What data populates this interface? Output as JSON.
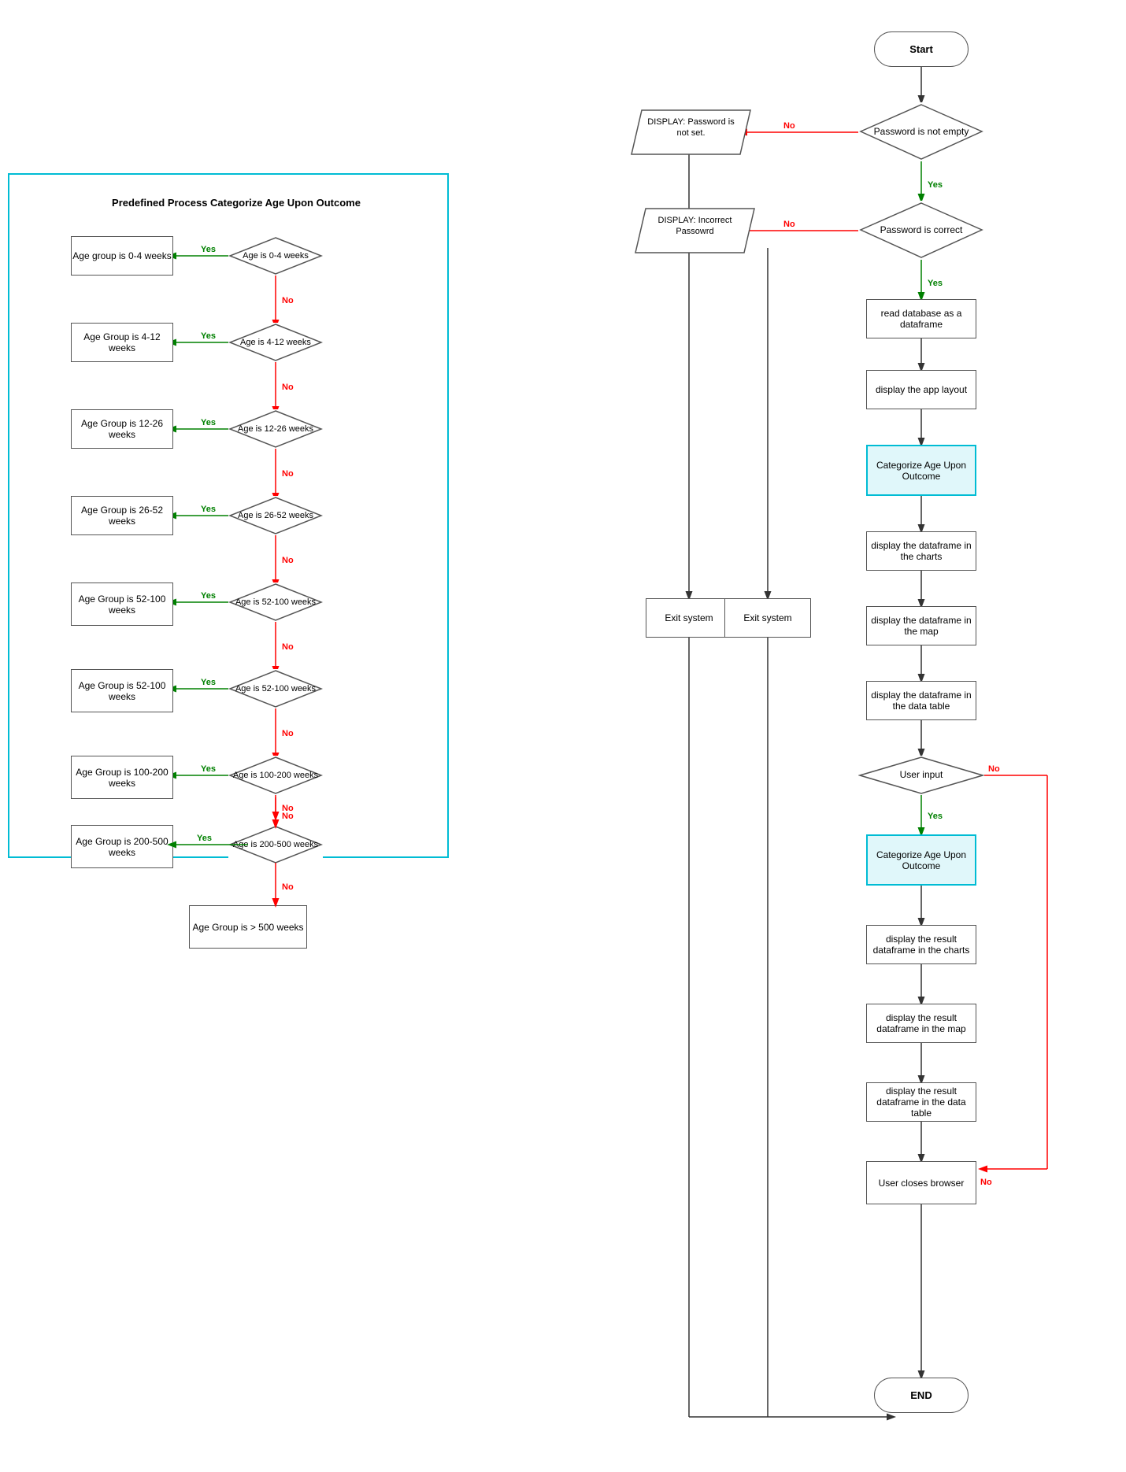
{
  "left_diagram": {
    "title": "Predefined Process Categorize Age Upon Outcome",
    "nodes": [
      {
        "id": "n1",
        "label": "Age group is 0-4 weeks",
        "type": "rect"
      },
      {
        "id": "n2",
        "label": "Age is 0-4 weeks",
        "type": "diamond"
      },
      {
        "id": "n3",
        "label": "Age Group is 4-12 weeks",
        "type": "rect"
      },
      {
        "id": "n4",
        "label": "Age is 4-12 weeks",
        "type": "diamond"
      },
      {
        "id": "n5",
        "label": "Age Group is 12-26 weeks",
        "type": "rect"
      },
      {
        "id": "n6",
        "label": "Age is 12-26 weeks",
        "type": "diamond"
      },
      {
        "id": "n7",
        "label": "Age Group is 26-52 weeks",
        "type": "rect"
      },
      {
        "id": "n8",
        "label": "Age is 26-52 weeks",
        "type": "diamond"
      },
      {
        "id": "n9",
        "label": "Age Group is 52-100 weeks",
        "type": "rect"
      },
      {
        "id": "n10",
        "label": "Age is 52-100 weeks",
        "type": "diamond"
      },
      {
        "id": "n11",
        "label": "Age Group is 52-100 weeks",
        "type": "rect"
      },
      {
        "id": "n12",
        "label": "Age is 52-100 weeks",
        "type": "diamond"
      },
      {
        "id": "n13",
        "label": "Age Group is 100-200 weeks",
        "type": "rect"
      },
      {
        "id": "n14",
        "label": "Age is 100-200 weeks",
        "type": "diamond"
      },
      {
        "id": "n15",
        "label": "Age Group is 200-500 weeks",
        "type": "rect"
      },
      {
        "id": "n16",
        "label": "Age is 200-500 weeks",
        "type": "diamond"
      },
      {
        "id": "n17",
        "label": "Age Group is > 500 weeks",
        "type": "rect"
      }
    ],
    "labels": {
      "yes": "Yes",
      "no": "No"
    }
  },
  "right_diagram": {
    "nodes": [
      {
        "id": "start",
        "label": "Start",
        "type": "rounded"
      },
      {
        "id": "d1",
        "label": "Password is not empty",
        "type": "diamond"
      },
      {
        "id": "disp1",
        "label": "DISPLAY: Password is not set.",
        "type": "parallelogram"
      },
      {
        "id": "d2",
        "label": "Password is correct",
        "type": "diamond"
      },
      {
        "id": "disp2",
        "label": "DISPLAY: Incorrect Passowrd",
        "type": "parallelogram"
      },
      {
        "id": "r1",
        "label": "read database as a dataframe",
        "type": "rect"
      },
      {
        "id": "r2",
        "label": "display the app layout",
        "type": "rect"
      },
      {
        "id": "r3",
        "label": "Categorize Age Upon Outcome",
        "type": "rect",
        "cyan": true
      },
      {
        "id": "r4",
        "label": "display the dataframe in the charts",
        "type": "rect"
      },
      {
        "id": "r5",
        "label": "display the dataframe in the map",
        "type": "rect"
      },
      {
        "id": "r6",
        "label": "display the dataframe in the data table",
        "type": "rect"
      },
      {
        "id": "d3",
        "label": "User input",
        "type": "diamond"
      },
      {
        "id": "r7",
        "label": "Categorize Age Upon Outcome",
        "type": "rect",
        "cyan": true
      },
      {
        "id": "r8",
        "label": "display the result dataframe in the charts",
        "type": "rect"
      },
      {
        "id": "r9",
        "label": "display the result dataframe in the map",
        "type": "rect"
      },
      {
        "id": "r10",
        "label": "display the result dataframe in the data table",
        "type": "rect"
      },
      {
        "id": "r11",
        "label": "User closes browser",
        "type": "rect"
      },
      {
        "id": "exit1",
        "label": "Exit system",
        "type": "rect"
      },
      {
        "id": "exit2",
        "label": "Exit system",
        "type": "rect"
      },
      {
        "id": "end",
        "label": "END",
        "type": "rounded"
      }
    ],
    "labels": {
      "yes": "Yes",
      "no": "No"
    }
  }
}
